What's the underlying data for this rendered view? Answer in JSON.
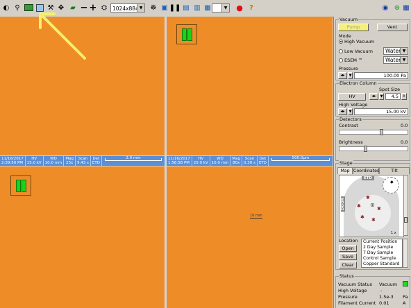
{
  "toolbar": {
    "resolution": "1024x884",
    "help_label": "?"
  },
  "quadrants": {
    "q1": {
      "databar": {
        "date": "11/16/2017",
        "time": "2:39:50 PM",
        "hv_label": "HV",
        "hv_value": "15.0 kV",
        "wd_label": "WD",
        "wd_value": "10.0 mm",
        "mag_label": "Mag",
        "mag_value": "23x",
        "scan_label": "Scan",
        "scan_value": "9.43 s",
        "det_label": "Det",
        "det_value": "ETD",
        "scale_label": "2.0 mm"
      }
    },
    "q2": {
      "databar": {
        "date": "11/16/2017",
        "time": "1:58:58 PM",
        "hv_label": "HV",
        "hv_value": "20.0 kV",
        "wd_label": "WD",
        "wd_value": "10.0 mm",
        "mag_label": "Mag",
        "mag_value": "80x",
        "scan_label": "Scan",
        "scan_value": "0.30 s",
        "det_label": "Det",
        "det_value": "ETD",
        "scale_label": "500.0µm"
      }
    },
    "q4": {
      "tiny_label": "10 mm"
    }
  },
  "panel": {
    "vacuum": {
      "title": "Vacuum",
      "pump_label": "Pump",
      "vent_label": "Vent",
      "mode_title": "Mode",
      "high_vacuum": "High Vacuum",
      "low_vacuum": "Low Vacuum",
      "esem": "ESEM ™",
      "low_vac_gas": "Water",
      "esem_gas": "Water",
      "pressure_title": "Pressure",
      "pressure_value": "100.00 Pa"
    },
    "electron_column": {
      "title": "Electron Column",
      "spot_size_label": "Spot Size",
      "hv_button": "HV",
      "spot_size_value": "4.5",
      "high_voltage_label": "High Voltage",
      "high_voltage_value": "15.00 kV"
    },
    "detectors": {
      "title": "Detectors",
      "contrast_label": "Contrast",
      "contrast_value": "0.0",
      "contrast_level": 0.62,
      "brightness_label": "Brightness",
      "brightness_value": "0.0",
      "brightness_level": 0.38
    },
    "stage": {
      "title": "Stage",
      "tabs": [
        "Map",
        "Coordinates",
        "Tilt Correction"
      ],
      "map_top_label": "ETD",
      "map_side_label": "DOOR",
      "map_scale_label": "1 x",
      "location_label": "Location",
      "open_label": "Open",
      "save_label": "Save",
      "clear_label": "Clear",
      "locations": [
        "Current Position",
        "2 Day Sample",
        "7 Day Sample",
        "Control Sample",
        "Copper Standard"
      ]
    },
    "status": {
      "title": "Status",
      "rows": [
        {
          "label": "Vacuum Status",
          "value": "Vacuum",
          "unit": ""
        },
        {
          "label": "High Voltage",
          "value": "-",
          "unit": ""
        },
        {
          "label": "Pressure",
          "value": "1.5e-3",
          "unit": "Pa"
        },
        {
          "label": "Filament Current",
          "value": "0.01",
          "unit": "A"
        }
      ],
      "ok_color": "#22dd22"
    }
  },
  "colors": {
    "quad_bg": "#ee8c28",
    "databar_bg": "#5b8fd6",
    "arrow": "#f5f06a"
  }
}
